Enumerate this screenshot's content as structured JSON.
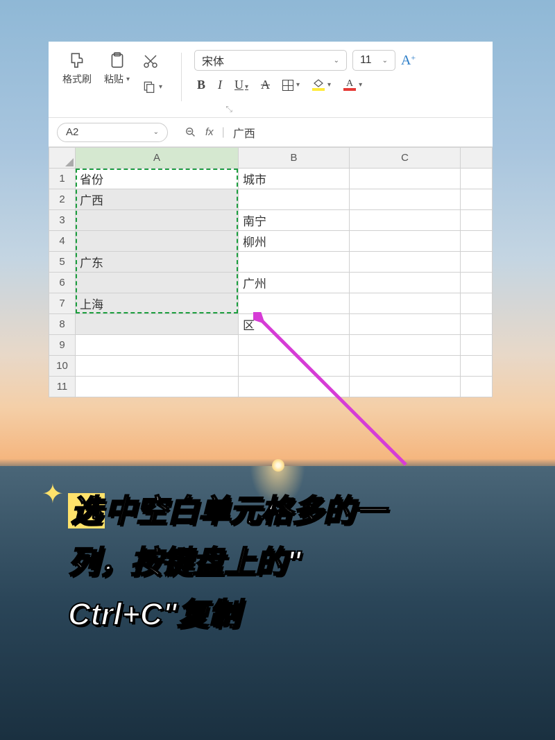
{
  "ribbon": {
    "format_painter": "格式刷",
    "paste": "粘贴",
    "font_name": "宋体",
    "font_size": "11",
    "bold": "B",
    "italic": "I",
    "underline": "U",
    "strike": "A"
  },
  "namebox": {
    "cell_ref": "A2",
    "formula_value": "广西",
    "fx_label": "fx"
  },
  "columns": [
    "A",
    "B",
    "C"
  ],
  "rows": [
    "1",
    "2",
    "3",
    "4",
    "5",
    "6",
    "7",
    "8",
    "9",
    "10",
    "11"
  ],
  "cells": {
    "A1": "省份",
    "B1": "城市",
    "A2": "广西",
    "B3": "南宁",
    "B4": "柳州",
    "A5": "广东",
    "B6": "广州",
    "A7": "上海",
    "B8": "区"
  },
  "caption": {
    "line1a": "选",
    "line1b": "中空白单元格多的一",
    "line2": "列，按键盘上的\"",
    "line3": "Ctrl+C\"复制"
  }
}
